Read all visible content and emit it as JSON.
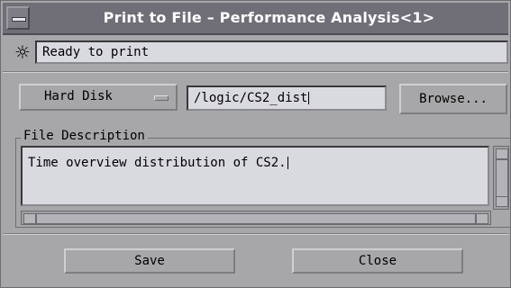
{
  "window": {
    "title": "Print to File – Performance Analysis<1>"
  },
  "status": {
    "icon": "sun-icon",
    "text": "Ready to print"
  },
  "destination": {
    "device": "Hard Disk",
    "path": "/logic/CS2_dist",
    "browse_label": "Browse..."
  },
  "description": {
    "group_label": "File Description",
    "text": "Time overview distribution of CS2."
  },
  "actions": {
    "save_label": "Save",
    "close_label": "Close"
  }
}
